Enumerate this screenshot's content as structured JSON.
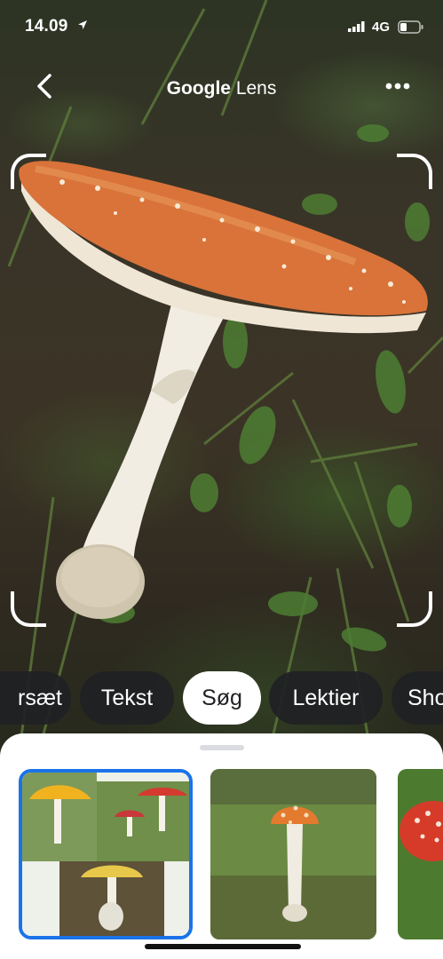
{
  "status_bar": {
    "time": "14.09",
    "network": "4G"
  },
  "header": {
    "title_brand": "Google",
    "title_product": "Lens",
    "back_icon": "chevron-left-icon",
    "more_icon": "more-horizontal-icon"
  },
  "modes": {
    "items": [
      {
        "label": "rsæt",
        "active": false
      },
      {
        "label": "Tekst",
        "active": false
      },
      {
        "label": "Søg",
        "active": true
      },
      {
        "label": "Lektier",
        "active": false
      },
      {
        "label": "Sho",
        "active": false
      }
    ]
  },
  "results": {
    "items": [
      {
        "selected": true
      },
      {
        "selected": false
      },
      {
        "selected": false
      }
    ]
  },
  "colors": {
    "accent": "#1a73e8",
    "mushroom_cap": "#d9733a",
    "sheet_bg": "#ffffff",
    "chip_bg": "#202124"
  }
}
